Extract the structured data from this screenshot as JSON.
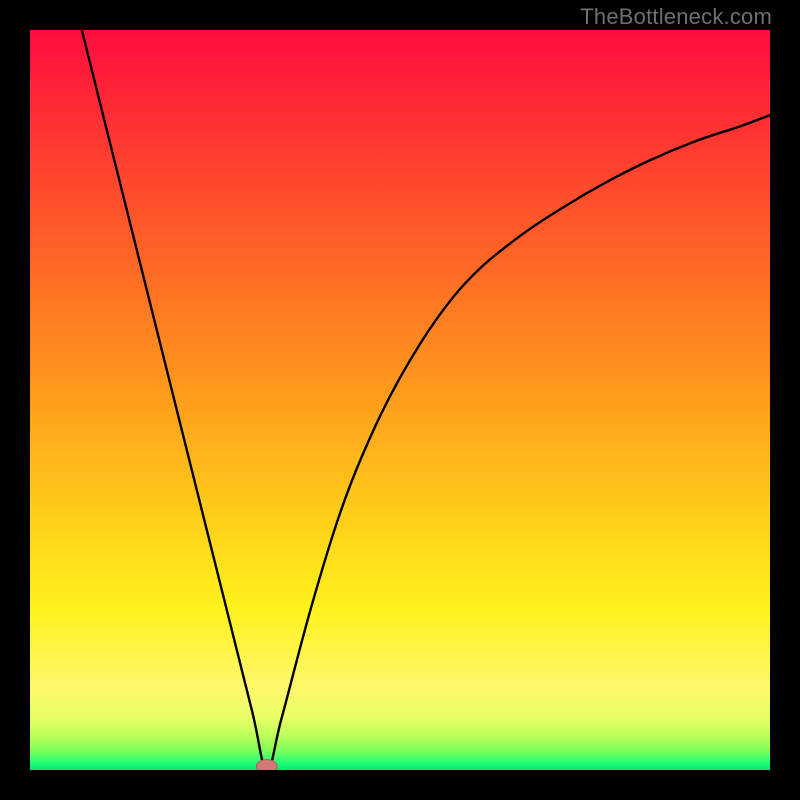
{
  "watermark": "TheBottleneck.com",
  "colors": {
    "frame": "#000000",
    "curve": "#000000",
    "marker_fill": "#cf7a78",
    "marker_stroke": "#b55a58",
    "gradient_stops": [
      {
        "offset": 0.0,
        "color": "#ff0d3f"
      },
      {
        "offset": 0.12,
        "color": "#ff2f33"
      },
      {
        "offset": 0.28,
        "color": "#ff5d28"
      },
      {
        "offset": 0.45,
        "color": "#ff8f1e"
      },
      {
        "offset": 0.62,
        "color": "#ffc31a"
      },
      {
        "offset": 0.78,
        "color": "#fff21c"
      },
      {
        "offset": 0.885,
        "color": "#fff76a"
      },
      {
        "offset": 0.93,
        "color": "#e8ff66"
      },
      {
        "offset": 0.955,
        "color": "#b8ff58"
      },
      {
        "offset": 0.975,
        "color": "#78ff5b"
      },
      {
        "offset": 0.99,
        "color": "#24ff76"
      },
      {
        "offset": 1.0,
        "color": "#00e570"
      }
    ]
  },
  "chart_data": {
    "type": "line",
    "title": "",
    "xlabel": "",
    "ylabel": "",
    "xlim": [
      0,
      100
    ],
    "ylim": [
      0,
      100
    ],
    "grid": false,
    "legend_position": "none",
    "annotations": [
      {
        "text": "TheBottleneck.com",
        "role": "watermark",
        "pos": "top-right"
      }
    ],
    "curve_minimum": {
      "x": 32,
      "y": 0
    },
    "marker": {
      "x": 32,
      "y": 0.5,
      "rx": 1.4,
      "ry": 0.9
    },
    "series": [
      {
        "name": "bottleneck-curve",
        "x": [
          7,
          10,
          14,
          18,
          22,
          26,
          30,
          32,
          34,
          38,
          42,
          46,
          50,
          55,
          60,
          66,
          72,
          78,
          84,
          90,
          96,
          100
        ],
        "y": [
          100,
          88,
          72,
          56,
          40,
          24,
          8,
          0,
          7,
          22,
          35,
          45,
          53,
          61,
          67,
          72,
          76,
          79.5,
          82.5,
          85,
          87,
          88.5
        ]
      }
    ]
  }
}
